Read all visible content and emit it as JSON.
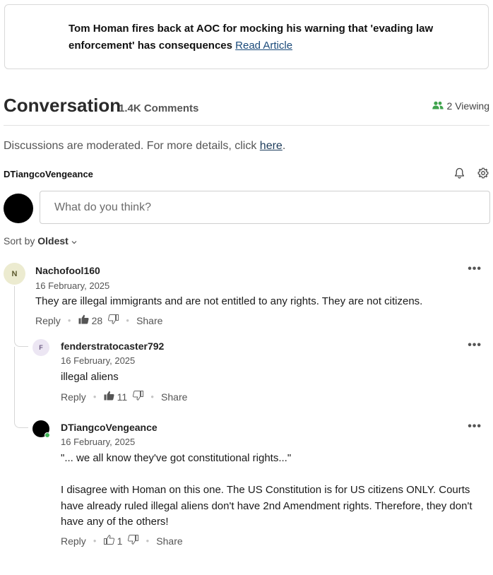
{
  "article": {
    "title": "Tom Homan fires back at AOC for mocking his warning that 'evading law enforcement' has consequences",
    "link_label": "Read Article"
  },
  "conversation": {
    "title": "Conversation",
    "count": "1.4K Comments",
    "viewing": "2 Viewing"
  },
  "moderation": {
    "text": "Discussions are moderated. For more details, click ",
    "link_label": "here",
    "suffix": "."
  },
  "current_user": {
    "name": "DTiangcoVengeance",
    "icons": [
      "bell-icon",
      "gear-icon"
    ]
  },
  "input": {
    "placeholder": "What do you think?"
  },
  "sort": {
    "label": "Sort by",
    "value": "Oldest"
  },
  "colors": {
    "online": "#3fb356",
    "link": "#1a4a7a",
    "viewers_icon": "#3fa34d"
  },
  "comments": [
    {
      "initial": "N",
      "author": "Nachofool160",
      "date": "16 February, 2025",
      "body": "They are illegal immigrants and are not entitled to any rights. They are not citizens.",
      "reply_label": "Reply",
      "likes": "28",
      "share_label": "Share",
      "liked": true
    },
    {
      "initial": "F",
      "author": "fenderstratocaster792",
      "date": "16 February, 2025",
      "body": "illegal aliens",
      "reply_label": "Reply",
      "likes": "11",
      "share_label": "Share",
      "liked": true
    },
    {
      "initial": "",
      "author": "DTiangcoVengeance",
      "date": "16 February, 2025",
      "quote": "\"... we all know they've got constitutional rights...\"",
      "body": "I disagree with Homan on this one. The US Constitution is for US citizens ONLY. Courts have already ruled illegal aliens don't have 2nd Amendment rights. Therefore, they don't have any of the others!",
      "reply_label": "Reply",
      "likes": "1",
      "share_label": "Share",
      "liked": false
    }
  ]
}
